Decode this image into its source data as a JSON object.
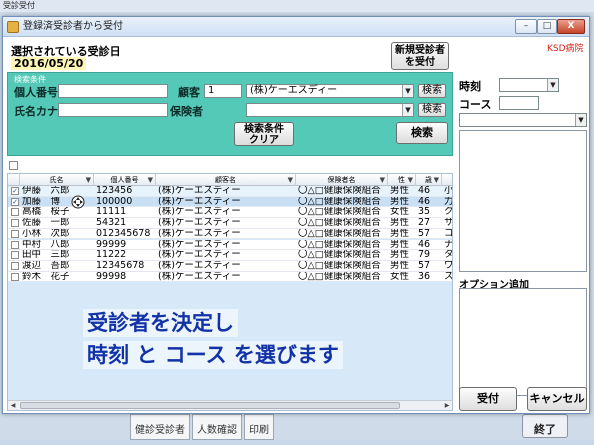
{
  "background_app": {
    "title": "受診受付",
    "tabs": [
      "健診受診者",
      "人数確認",
      "印刷"
    ],
    "finish_label": "終了"
  },
  "dialog": {
    "title": "登録済受診者から受付",
    "window_buttons": {
      "minimize": "–",
      "maximize": "□",
      "close": "X"
    },
    "selected_date_caption": "選択されている受診日",
    "selected_date": "2016/05/20",
    "new_patient_button": [
      "新規受診者",
      "を受付"
    ],
    "clinic_name": "KSD病院"
  },
  "search": {
    "legend": "検索条件",
    "personal_no_label": "個人番号",
    "personal_no_value": "",
    "name_kana_label": "氏名カナ",
    "name_kana_value": "",
    "customer_label": "顧客",
    "customer_code": "1",
    "customer_name": "(株)ケーエスディー",
    "insurer_label": "保険者",
    "insurer_value": "",
    "lookup_button": "検索",
    "clear_button": [
      "検索条件",
      "クリア"
    ],
    "search_button": "検索"
  },
  "grid": {
    "columns": [
      "氏名",
      "個人番号",
      "顧客名",
      "保険者名",
      "性",
      "歳"
    ],
    "rows": [
      {
        "checked": true,
        "name": "伊藤　六郎",
        "no": "123456",
        "customer": "(株)ケーエスディー",
        "insurer": "〇△□健康保険組合",
        "sex": "男性",
        "age": "46",
        "extra": "小"
      },
      {
        "checked": true,
        "name": "加藤　博",
        "no": "100000",
        "customer": "(株)ケーエスディー",
        "insurer": "〇△□健康保険組合",
        "sex": "男性",
        "age": "46",
        "extra": "力"
      },
      {
        "checked": false,
        "name": "高橋　桜子",
        "no": "11111",
        "customer": "(株)ケーエスディー",
        "insurer": "〇△□健康保険組合",
        "sex": "女性",
        "age": "35",
        "extra": "ク"
      },
      {
        "checked": false,
        "name": "佐藤　一郎",
        "no": "54321",
        "customer": "(株)ケーエスディー",
        "insurer": "〇△□健康保険組合",
        "sex": "男性",
        "age": "27",
        "extra": "サ"
      },
      {
        "checked": false,
        "name": "小林　次郎",
        "no": "012345678",
        "customer": "(株)ケーエスディー",
        "insurer": "〇△□健康保険組合",
        "sex": "男性",
        "age": "57",
        "extra": "コ"
      },
      {
        "checked": false,
        "name": "中村　八郎",
        "no": "99999",
        "customer": "(株)ケーエスディー",
        "insurer": "〇△□健康保険組合",
        "sex": "男性",
        "age": "46",
        "extra": "ナ"
      },
      {
        "checked": false,
        "name": "田中　三郎",
        "no": "11222",
        "customer": "(株)ケーエスディー",
        "insurer": "〇△□健康保険組合",
        "sex": "男性",
        "age": "79",
        "extra": "タ"
      },
      {
        "checked": false,
        "name": "渡辺　吾郎",
        "no": "12345678",
        "customer": "(株)ケーエスディー",
        "insurer": "〇△□健康保険組合",
        "sex": "男性",
        "age": "57",
        "extra": "ワ"
      },
      {
        "checked": false,
        "name": "鈴木　花子",
        "no": "99998",
        "customer": "(株)ケーエスディー",
        "insurer": "〇△□健康保険組合",
        "sex": "女性",
        "age": "36",
        "extra": "ス"
      }
    ]
  },
  "right_panel": {
    "time_label": "時刻",
    "time_value": "",
    "course_label": "コース",
    "course_value": "",
    "option_label": "オプション追加",
    "accept_button": "受付",
    "cancel_button": "キャンセル"
  },
  "overlay": {
    "line1": "受診者を決定し",
    "line2": "時刻 と コース を選びます"
  }
}
